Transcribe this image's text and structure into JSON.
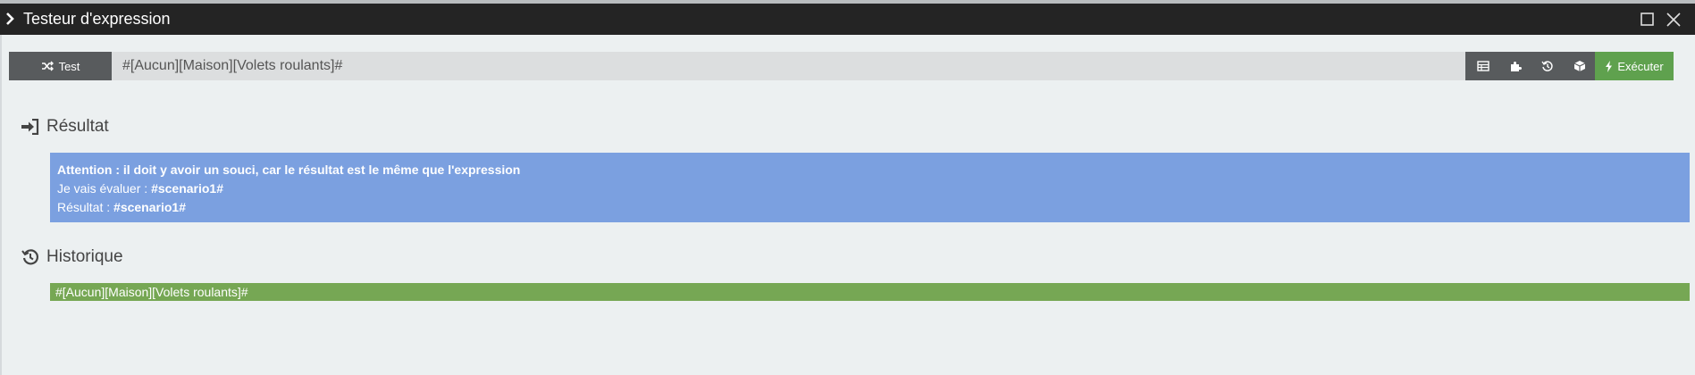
{
  "window": {
    "title": "Testeur d'expression",
    "icons": {
      "left": "chevron-right-icon",
      "maximize": "maximize-icon",
      "close": "close-icon"
    }
  },
  "toolbar": {
    "test_label": "Test",
    "test_icon": "shuffle-icon",
    "expression_value": "#[Aucun][Maison][Volets roulants]#",
    "tools": [
      "table-icon",
      "puzzle-icon",
      "history-icon",
      "cube-icon"
    ],
    "run_label": "Exécuter",
    "run_icon": "bolt-icon"
  },
  "result": {
    "heading": "Résultat",
    "warning": "Attention : il doit y avoir un souci, car le résultat est le même que l'expression",
    "evaluate_label": "Je vais évaluer :",
    "evaluate_value": "#scenario1#",
    "result_label": "Résultat :",
    "result_value": "#scenario1#"
  },
  "history": {
    "heading": "Historique",
    "items": [
      "#[Aucun][Maison][Volets roulants]#"
    ]
  },
  "colors": {
    "titlebar": "#242424",
    "background": "#ecf0f1",
    "result_box": "#7ba0e0",
    "history_item": "#76a754",
    "run_button": "#5fa14e",
    "dark_button": "#585b5d"
  }
}
